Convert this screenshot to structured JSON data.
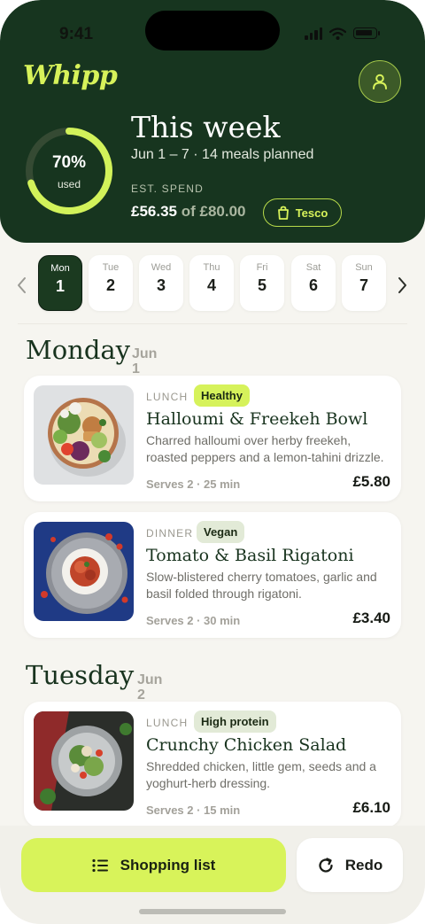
{
  "status_bar": {
    "time": "9:41"
  },
  "header": {
    "logo": "Whipp",
    "budget_used_pct": 70,
    "budget_pct_label": "70%",
    "budget_used_label": "used",
    "title": "This week",
    "subtitle": "Jun 1 – 7 · 14 meals planned",
    "spend_label": "EST. SPEND",
    "spend_amount": "£56.35",
    "spend_of": "of £80.00",
    "store": "Tesco"
  },
  "day_strip": [
    {
      "name": "Mon",
      "num": "1",
      "active": true
    },
    {
      "name": "Tue",
      "num": "2",
      "active": false
    },
    {
      "name": "Wed",
      "num": "3",
      "active": false
    },
    {
      "name": "Thu",
      "num": "4",
      "active": false
    },
    {
      "name": "Fri",
      "num": "5",
      "active": false
    },
    {
      "name": "Sat",
      "num": "6",
      "active": false
    },
    {
      "name": "Sun",
      "num": "7",
      "active": false
    }
  ],
  "days": [
    {
      "heading": "Monday",
      "date_month": "Jun",
      "date_day": "1",
      "meals": [
        {
          "type": "LUNCH",
          "tag": "Healthy",
          "title": "Halloumi & Freekeh Bowl",
          "description": "Charred halloumi over herby freekeh, roasted peppers and a lemon-tahini drizzle.",
          "meta": "Serves 2 · 25 min",
          "price": "£5.80"
        },
        {
          "type": "DINNER",
          "tag": "Vegan",
          "title": "Tomato & Basil Rigatoni",
          "description": "Slow-blistered cherry tomatoes, garlic and basil folded through rigatoni.",
          "meta": "Serves 2 · 30 min",
          "price": "£3.40"
        }
      ]
    },
    {
      "heading": "Tuesday",
      "date_month": "Jun",
      "date_day": "2",
      "meals": [
        {
          "type": "LUNCH",
          "tag": "High protein",
          "title": "Crunchy Chicken Salad",
          "description": "Shredded chicken, little gem, seeds and a yoghurt-herb dressing.",
          "meta": "Serves 2 · 15 min",
          "price": "£6.10"
        }
      ]
    }
  ],
  "actions": {
    "shopping_list": "Shopping list",
    "redo": "Redo"
  },
  "colors": {
    "header_bg": "#17351f",
    "accent_lime": "#d7f25a",
    "page_bg": "#f6f5f0"
  }
}
